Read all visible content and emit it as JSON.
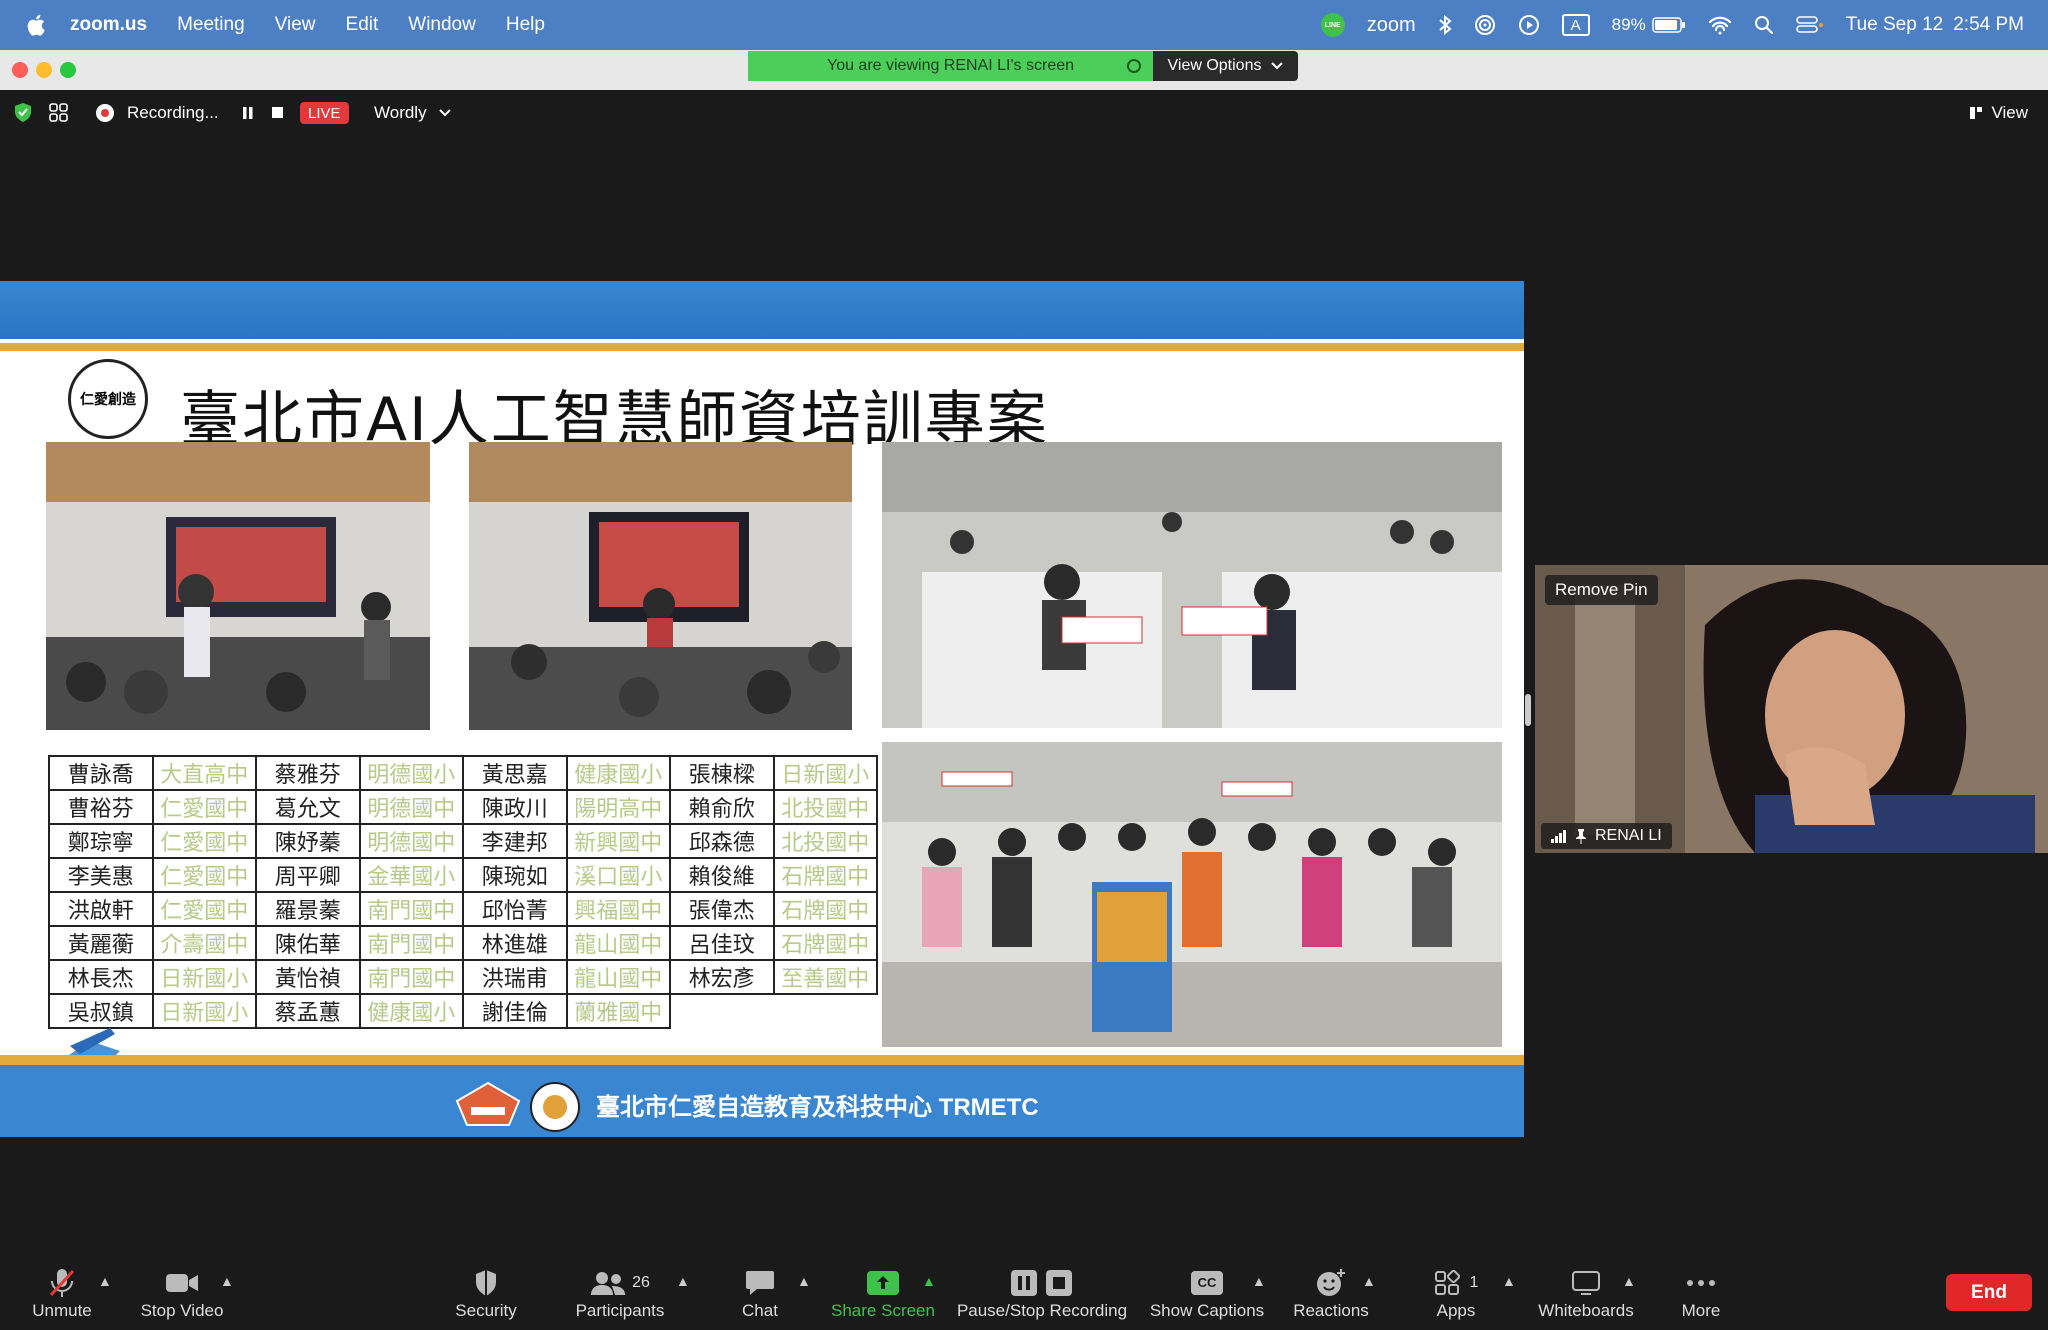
{
  "menubar": {
    "app_name": "zoom.us",
    "menus": [
      "Meeting",
      "View",
      "Edit",
      "Window",
      "Help"
    ],
    "zoom_logo": "zoom",
    "battery": "89%",
    "input_source": "A",
    "date": "Tue Sep 12",
    "time": "2:54 PM",
    "line_badge": "LINE"
  },
  "banner": {
    "viewing_text": "You are viewing RENAI LI's screen",
    "view_options": "View Options"
  },
  "topbar": {
    "recording": "Recording...",
    "live": "LIVE",
    "wordly": "Wordly",
    "view": "View"
  },
  "slide": {
    "title": "臺北市AI人工智慧師資培訓專案",
    "logo_text": "仁愛創造",
    "footer": "臺北市仁愛自造教育及科技中心 TRMETC",
    "roster": [
      [
        "曹詠喬",
        "大直高中",
        "蔡雅芬",
        "明德國小",
        "黃思嘉",
        "健康國小",
        "張棟樑",
        "日新國小"
      ],
      [
        "曹裕芬",
        "仁愛國中",
        "葛允文",
        "明德國中",
        "陳政川",
        "陽明高中",
        "賴俞欣",
        "北投國中"
      ],
      [
        "鄭琮寧",
        "仁愛國中",
        "陳妤蓁",
        "明德國中",
        "李建邦",
        "新興國中",
        "邱森德",
        "北投國中"
      ],
      [
        "李美惠",
        "仁愛國中",
        "周平卿",
        "金華國小",
        "陳琬如",
        "溪口國小",
        "賴俊維",
        "石牌國中"
      ],
      [
        "洪啟軒",
        "仁愛國中",
        "羅景蓁",
        "南門國中",
        "邱怡菁",
        "興福國中",
        "張偉杰",
        "石牌國中"
      ],
      [
        "黃麗蘅",
        "介壽國中",
        "陳佑華",
        "南門國中",
        "林進雄",
        "龍山國中",
        "呂佳玟",
        "石牌國中"
      ],
      [
        "林長杰",
        "日新國小",
        "黃怡禎",
        "南門國中",
        "洪瑞甫",
        "龍山國中",
        "林宏彥",
        "至善國中"
      ],
      [
        "吳叔鎮",
        "日新國小",
        "蔡孟蕙",
        "健康國小",
        "謝佳倫",
        "蘭雅國中",
        "",
        ""
      ]
    ]
  },
  "pip": {
    "remove_pin": "Remove Pin",
    "name": "RENAI LI"
  },
  "toolbar": {
    "unmute": "Unmute",
    "stop_video": "Stop Video",
    "security": "Security",
    "participants": "Participants",
    "participants_count": "26",
    "chat": "Chat",
    "share_screen": "Share Screen",
    "pause_stop_recording": "Pause/Stop Recording",
    "show_captions": "Show Captions",
    "captions_badge": "CC",
    "reactions": "Reactions",
    "apps": "Apps",
    "apps_count": "1",
    "whiteboards": "Whiteboards",
    "more": "More",
    "end": "End"
  },
  "colors": {
    "menubar": "#4d7fc4",
    "banner_green": "#4ccf5a",
    "slide_blue": "#3a86d0",
    "slide_gold": "#e3a93a",
    "end_red": "#e02828",
    "share_green": "#3ec24a"
  }
}
